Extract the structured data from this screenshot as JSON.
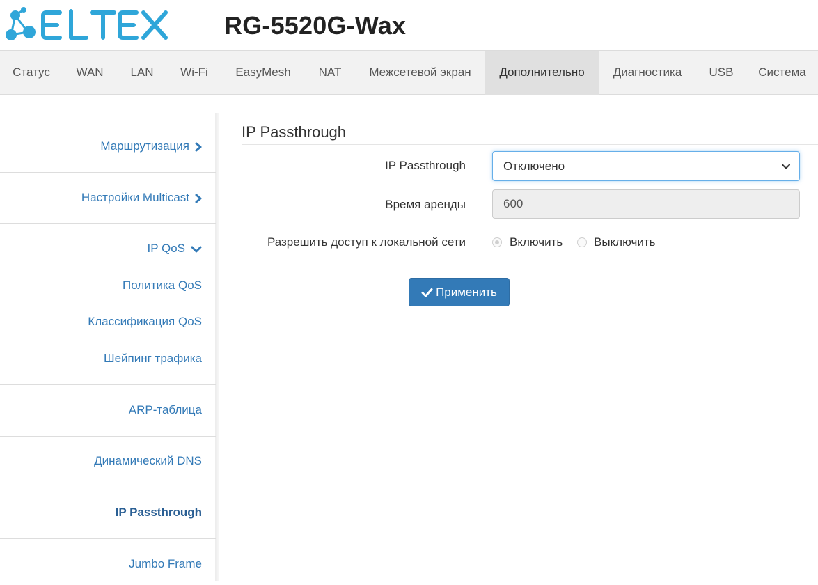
{
  "header": {
    "brand": "ELTEX",
    "device_title": "RG-5520G-Wax",
    "brand_color": "#2fa6d9"
  },
  "topnav": {
    "tabs": [
      {
        "label": "Статус"
      },
      {
        "label": "WAN"
      },
      {
        "label": "LAN"
      },
      {
        "label": "Wi-Fi"
      },
      {
        "label": "EasyMesh"
      },
      {
        "label": "NAT"
      },
      {
        "label": "Межсетевой экран"
      },
      {
        "label": "Дополнительно",
        "active": true
      },
      {
        "label": "Диагностика"
      },
      {
        "label": "USB"
      },
      {
        "label": "Система"
      }
    ]
  },
  "sidebar": {
    "items": [
      {
        "label": "Маршрутизация",
        "icon": "chevron-right-icon"
      },
      {
        "label": "Настройки Multicast",
        "icon": "chevron-right-icon"
      },
      {
        "label": "IP QoS",
        "icon": "chevron-down-icon"
      },
      {
        "label": "Политика QoS"
      },
      {
        "label": "Классификация QoS"
      },
      {
        "label": "Шейпинг трафика"
      },
      {
        "label": "ARP-таблица"
      },
      {
        "label": "Динамический DNS"
      },
      {
        "label": "IP Passthrough",
        "active": true
      },
      {
        "label": "Jumbo Frame"
      }
    ]
  },
  "main": {
    "section_title": "IP Passthrough",
    "form": {
      "passthrough_label": "IP Passthrough",
      "passthrough_value": "Отключено",
      "lease_label": "Время аренды",
      "lease_value": "600",
      "lan_access_label": "Разрешить доступ к локальной сети",
      "radio_enable": "Включить",
      "radio_disable": "Выключить",
      "radio_selected": "Включить"
    },
    "apply_label": "Применить",
    "accent_color": "#337ab7"
  }
}
